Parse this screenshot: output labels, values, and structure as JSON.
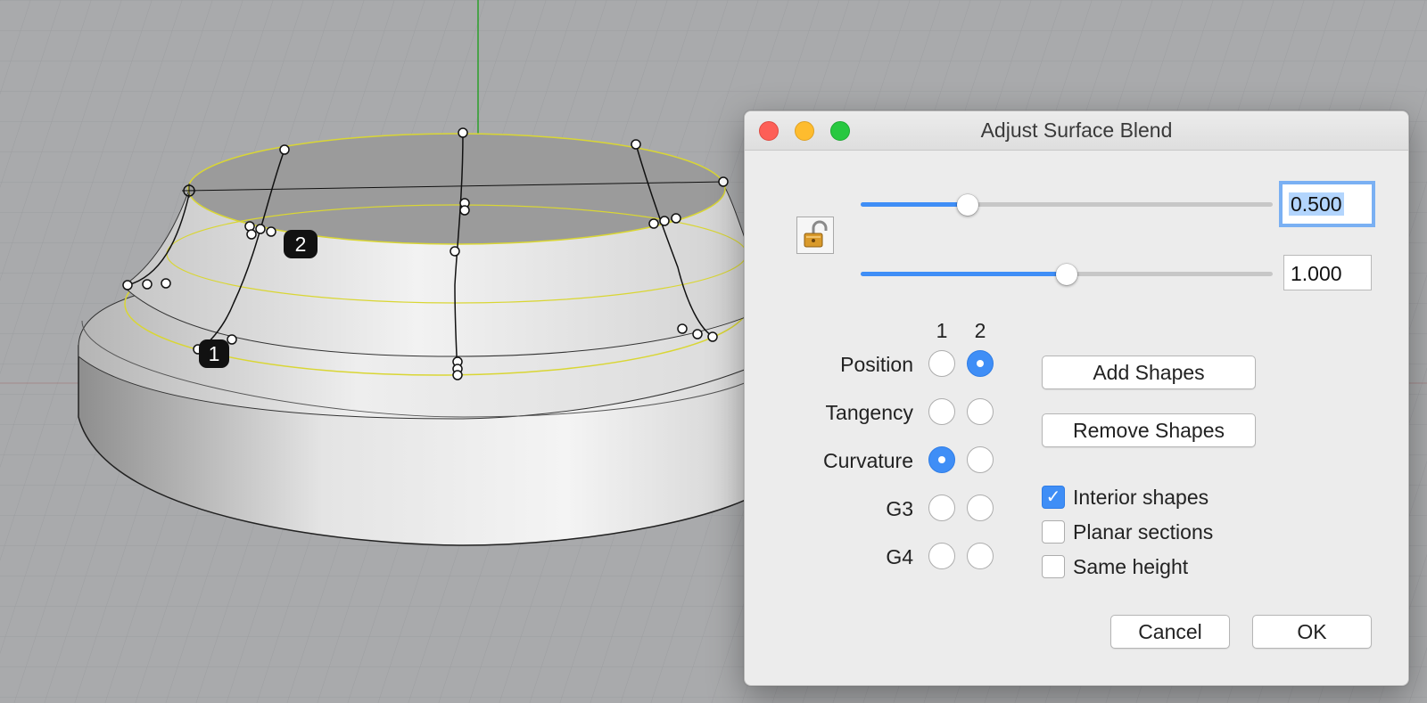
{
  "viewport": {
    "point_labels": [
      "1",
      "2"
    ]
  },
  "dialog": {
    "title": "Adjust Surface Blend",
    "slider1": {
      "value": 0.5,
      "display": "0.500",
      "fill_fraction": 0.26
    },
    "slider2": {
      "value": 1.0,
      "display": "1.000",
      "fill_fraction": 0.5
    },
    "column_headers": [
      "1",
      "2"
    ],
    "continuity_rows": [
      {
        "label": "Position",
        "side1": false,
        "side2": true
      },
      {
        "label": "Tangency",
        "side1": false,
        "side2": false
      },
      {
        "label": "Curvature",
        "side1": true,
        "side2": false
      },
      {
        "label": "G3",
        "side1": false,
        "side2": false
      },
      {
        "label": "G4",
        "side1": false,
        "side2": false
      }
    ],
    "add_shapes_label": "Add Shapes",
    "remove_shapes_label": "Remove Shapes",
    "checkboxes": [
      {
        "label": "Interior shapes",
        "checked": true
      },
      {
        "label": "Planar sections",
        "checked": false
      },
      {
        "label": "Same height",
        "checked": false
      }
    ],
    "cancel_label": "Cancel",
    "ok_label": "OK"
  },
  "colors": {
    "accent": "#3f8ef6",
    "viewport_bg": "#a9aaac",
    "dialog_bg": "#ececec"
  }
}
